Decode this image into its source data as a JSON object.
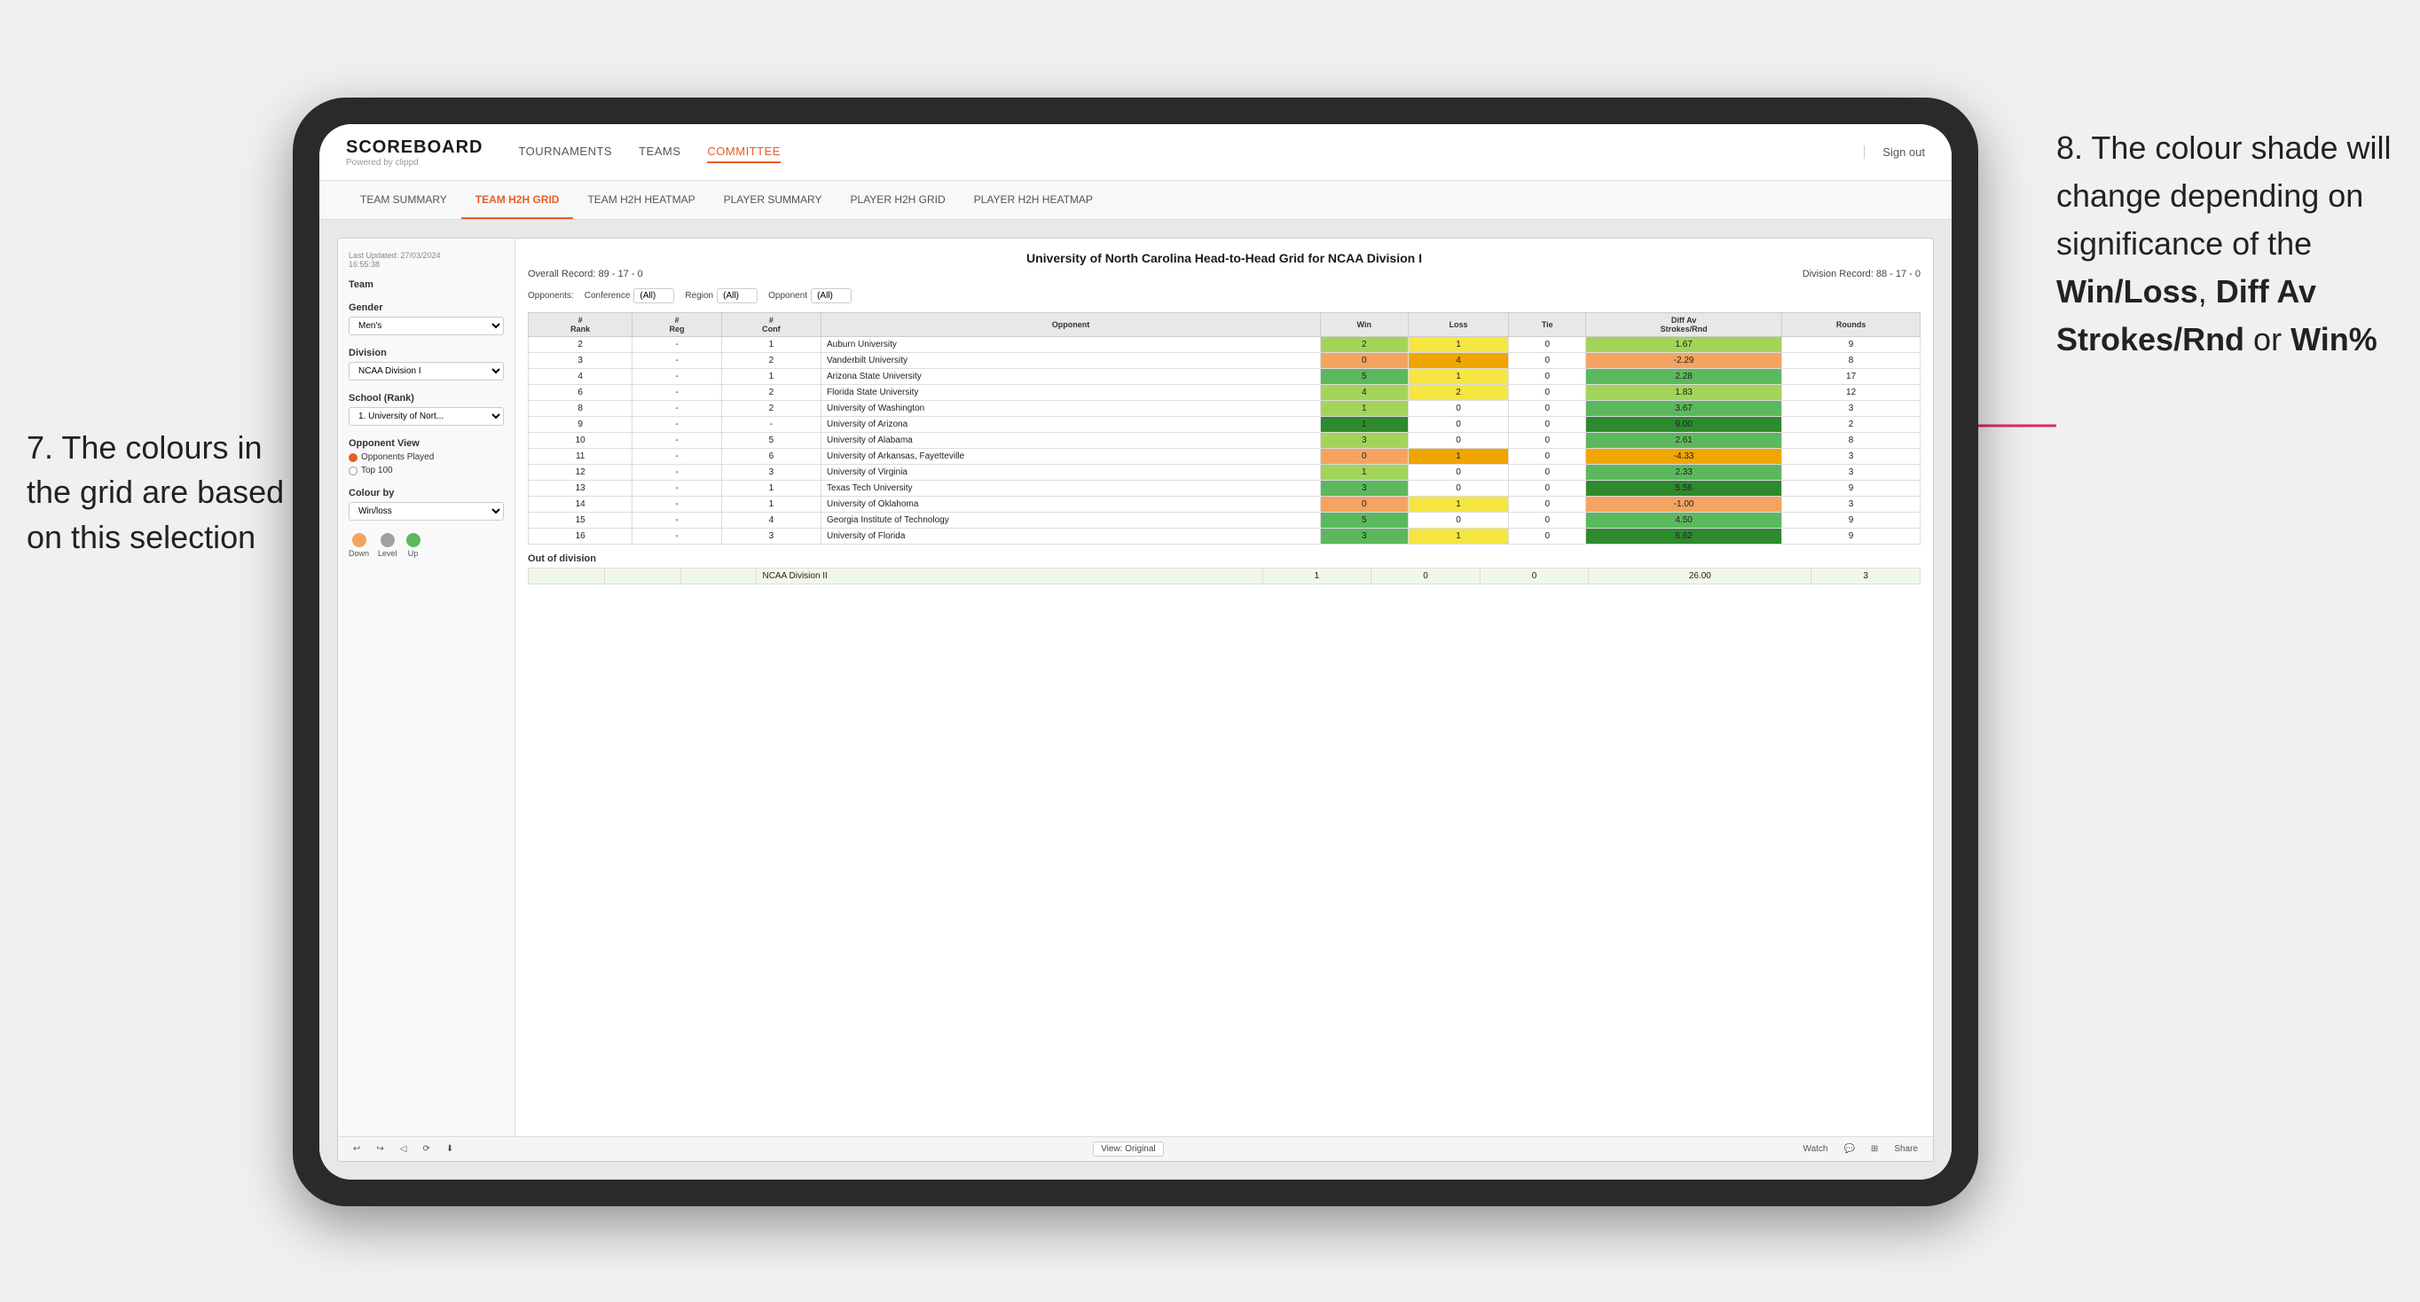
{
  "annotations": {
    "left": {
      "line1": "7. The colours in",
      "line2": "the grid are based",
      "line3": "on this selection"
    },
    "right": {
      "intro": "8. The colour shade will change depending on significance of the ",
      "bold1": "Win/Loss",
      "sep1": ", ",
      "bold2": "Diff Av Strokes/Rnd",
      "sep2": " or ",
      "bold3": "Win%"
    }
  },
  "nav": {
    "logo": "SCOREBOARD",
    "logo_sub": "Powered by clippd",
    "links": [
      "TOURNAMENTS",
      "TEAMS",
      "COMMITTEE"
    ],
    "sign_out": "Sign out"
  },
  "sub_nav": {
    "links": [
      "TEAM SUMMARY",
      "TEAM H2H GRID",
      "TEAM H2H HEATMAP",
      "PLAYER SUMMARY",
      "PLAYER H2H GRID",
      "PLAYER H2H HEATMAP"
    ]
  },
  "tableau": {
    "last_updated_label": "Last Updated: 27/03/2024",
    "last_updated_time": "16:55:38",
    "viz_title": "University of North Carolina Head-to-Head Grid for NCAA Division I",
    "overall_record": "Overall Record: 89 - 17 - 0",
    "division_record": "Division Record: 88 - 17 - 0",
    "filters": {
      "conference_label": "Conference",
      "conference_value": "(All)",
      "region_label": "Region",
      "region_value": "(All)",
      "opponent_label": "Opponent",
      "opponent_value": "(All)",
      "opponents_label": "Opponents:"
    },
    "left_panel": {
      "team_label": "Team",
      "gender_label": "Gender",
      "gender_value": "Men's",
      "division_label": "Division",
      "division_value": "NCAA Division I",
      "school_label": "School (Rank)",
      "school_value": "1. University of Nort...",
      "opponent_view_label": "Opponent View",
      "opponents_played": "Opponents Played",
      "top100": "Top 100",
      "colour_by_label": "Colour by",
      "colour_by_value": "Win/loss",
      "legend_down": "Down",
      "legend_level": "Level",
      "legend_up": "Up"
    },
    "table_headers": [
      "#\nRank",
      "#\nReg",
      "#\nConf",
      "Opponent",
      "Win",
      "Loss",
      "Tie",
      "Diff Av\nStrokes/Rnd",
      "Rounds"
    ],
    "rows": [
      {
        "rank": "2",
        "reg": "-",
        "conf": "1",
        "opponent": "Auburn University",
        "win": "2",
        "loss": "1",
        "tie": "0",
        "diff": "1.67",
        "rounds": "9",
        "win_color": "green_light",
        "loss_color": "yellow"
      },
      {
        "rank": "3",
        "reg": "-",
        "conf": "2",
        "opponent": "Vanderbilt University",
        "win": "0",
        "loss": "4",
        "tie": "0",
        "diff": "-2.29",
        "rounds": "8",
        "win_color": "red_light",
        "loss_color": "orange"
      },
      {
        "rank": "4",
        "reg": "-",
        "conf": "1",
        "opponent": "Arizona State University",
        "win": "5",
        "loss": "1",
        "tie": "0",
        "diff": "2.28",
        "rounds": "17",
        "win_color": "green_med",
        "loss_color": "yellow"
      },
      {
        "rank": "6",
        "reg": "-",
        "conf": "2",
        "opponent": "Florida State University",
        "win": "4",
        "loss": "2",
        "tie": "0",
        "diff": "1.83",
        "rounds": "12",
        "win_color": "green_light",
        "loss_color": "yellow"
      },
      {
        "rank": "8",
        "reg": "-",
        "conf": "2",
        "opponent": "University of Washington",
        "win": "1",
        "loss": "0",
        "tie": "0",
        "diff": "3.67",
        "rounds": "3",
        "win_color": "green_light",
        "loss_color": "white"
      },
      {
        "rank": "9",
        "reg": "-",
        "conf": "-",
        "opponent": "University of Arizona",
        "win": "1",
        "loss": "0",
        "tie": "0",
        "diff": "9.00",
        "rounds": "2",
        "win_color": "green_dark",
        "loss_color": "white"
      },
      {
        "rank": "10",
        "reg": "-",
        "conf": "5",
        "opponent": "University of Alabama",
        "win": "3",
        "loss": "0",
        "tie": "0",
        "diff": "2.61",
        "rounds": "8",
        "win_color": "green_light",
        "loss_color": "white"
      },
      {
        "rank": "11",
        "reg": "-",
        "conf": "6",
        "opponent": "University of Arkansas, Fayetteville",
        "win": "0",
        "loss": "1",
        "tie": "0",
        "diff": "-4.33",
        "rounds": "3",
        "win_color": "red_light",
        "loss_color": "orange"
      },
      {
        "rank": "12",
        "reg": "-",
        "conf": "3",
        "opponent": "University of Virginia",
        "win": "1",
        "loss": "0",
        "tie": "0",
        "diff": "2.33",
        "rounds": "3",
        "win_color": "green_light",
        "loss_color": "white"
      },
      {
        "rank": "13",
        "reg": "-",
        "conf": "1",
        "opponent": "Texas Tech University",
        "win": "3",
        "loss": "0",
        "tie": "0",
        "diff": "5.56",
        "rounds": "9",
        "win_color": "green_med",
        "loss_color": "white"
      },
      {
        "rank": "14",
        "reg": "-",
        "conf": "1",
        "opponent": "University of Oklahoma",
        "win": "0",
        "loss": "1",
        "tie": "0",
        "diff": "-1.00",
        "rounds": "3",
        "win_color": "red_light",
        "loss_color": "yellow"
      },
      {
        "rank": "15",
        "reg": "-",
        "conf": "4",
        "opponent": "Georgia Institute of Technology",
        "win": "5",
        "loss": "0",
        "tie": "0",
        "diff": "4.50",
        "rounds": "9",
        "win_color": "green_med",
        "loss_color": "white"
      },
      {
        "rank": "16",
        "reg": "-",
        "conf": "3",
        "opponent": "University of Florida",
        "win": "3",
        "loss": "1",
        "tie": "0",
        "diff": "6.62",
        "rounds": "9",
        "win_color": "green_med",
        "loss_color": "yellow"
      }
    ],
    "out_of_division": {
      "label": "Out of division",
      "division_name": "NCAA Division II",
      "win": "1",
      "loss": "0",
      "tie": "0",
      "diff": "26.00",
      "rounds": "3"
    },
    "bottom_bar": {
      "view_label": "View: Original",
      "watch": "Watch",
      "share": "Share"
    }
  }
}
